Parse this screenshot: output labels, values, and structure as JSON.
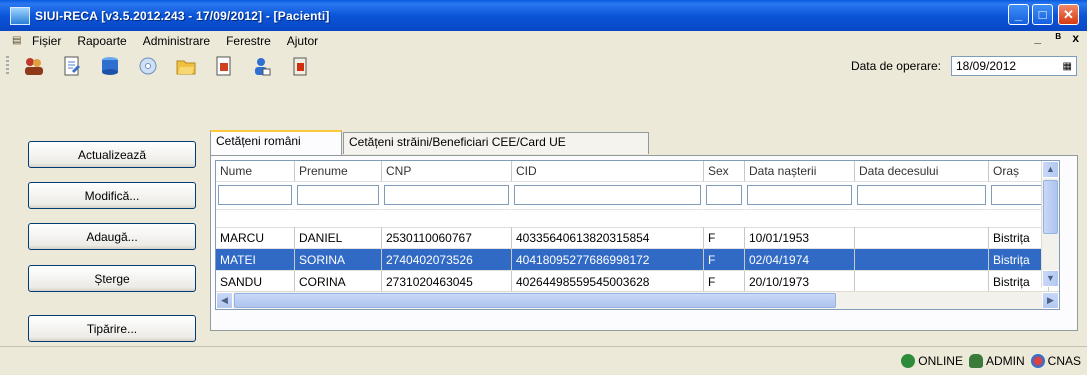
{
  "window": {
    "title": "SIUI-RECA [v3.5.2012.243 - 17/09/2012] - [Pacienti]",
    "min_glyph": "_",
    "max_glyph": "□",
    "close_glyph": "✕"
  },
  "menu": {
    "items": [
      "Fișier",
      "Rapoarte",
      "Administrare",
      "Ferestre",
      "Ajutor"
    ],
    "mdi_min": "_",
    "mdi_restore": "ᴮ",
    "mdi_close": "x"
  },
  "toolbar": {
    "date_label": "Data de operare:",
    "date_value": "18/09/2012",
    "date_drop": "▦"
  },
  "buttons": {
    "refresh": "Actualizează",
    "edit": "Modifică...",
    "add": "Adaugă...",
    "delete": "Șterge",
    "print": "Tipărire..."
  },
  "tabs": [
    "Cetățeni români",
    "Cetățeni străini/Beneficiari CEE/Card UE"
  ],
  "grid": {
    "columns": [
      "Nume",
      "Prenume",
      "CNP",
      "CID",
      "Sex",
      "Data nașterii",
      "Data decesului",
      "Oraș"
    ],
    "rows": [
      [
        "MARCU",
        "DANIEL",
        "2530110060767",
        "40335640613820315854",
        "F",
        "10/01/1953",
        "",
        "Bistrița"
      ],
      [
        "MATEI",
        "SORINA",
        "2740402073526",
        "40418095277686998172",
        "F",
        "02/04/1974",
        "",
        "Bistrița"
      ],
      [
        "SANDU",
        "CORINA",
        "2731020463045",
        "40264498559545003628",
        "F",
        "20/10/1973",
        "",
        "Bistrița"
      ]
    ],
    "selected_row": 1
  },
  "status": {
    "online": "ONLINE",
    "user": "ADMIN",
    "org": "CNAS"
  },
  "colors": {
    "selection": "#316ac5",
    "titlebar": "#0b55d8",
    "face": "#ece9d8"
  }
}
